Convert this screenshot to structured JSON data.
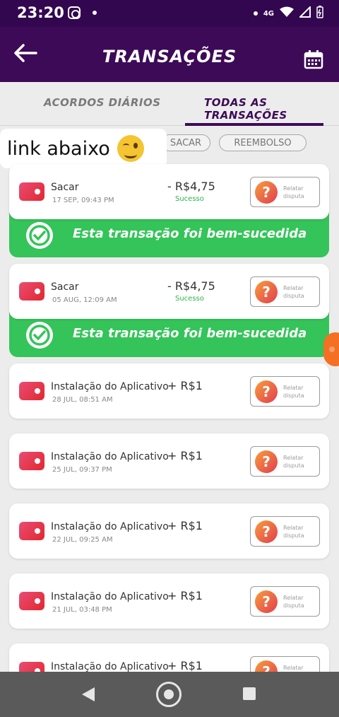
{
  "status_bar": {
    "time": "23:20",
    "network": "4G"
  },
  "app_bar": {
    "title": "TRANSAÇÕES"
  },
  "tabs": [
    {
      "label": "ACORDOS DIÁRIOS",
      "active": false
    },
    {
      "label": "TODAS AS TRANSAÇÕES",
      "active": true
    }
  ],
  "filters": [
    "SACAR",
    "REEMBOLSO"
  ],
  "sticker": {
    "text": "link abaixo"
  },
  "success_banner": "Esta transação foi bem-sucedida",
  "dispute_label": "Relatar disputa",
  "transactions": [
    {
      "name": "Sacar",
      "date": "17 SEP, 09:43 PM",
      "amount": "- R$4,75",
      "status": "Sucesso"
    },
    {
      "name": "Sacar",
      "date": "05 AUG, 12:09 AM",
      "amount": "- R$4,75",
      "status": "Sucesso"
    },
    {
      "name": "Instalação do Aplicativo",
      "date": "28 JUL, 08:51 AM",
      "amount": "+ R$1",
      "status": ""
    },
    {
      "name": "Instalação do Aplicativo",
      "date": "25 JUL, 09:37 PM",
      "amount": "+ R$1",
      "status": ""
    },
    {
      "name": "Instalação do Aplicativo",
      "date": "22 JUL, 09:25 AM",
      "amount": "+ R$1",
      "status": ""
    },
    {
      "name": "Instalação do Aplicativo",
      "date": "21 JUL, 03:48 PM",
      "amount": "+ R$1",
      "status": ""
    },
    {
      "name": "Instalação do Aplicativo",
      "date": "",
      "amount": "+ R$1",
      "status": ""
    }
  ],
  "colors": {
    "brand": "#3d0a57",
    "success": "#34c459",
    "accent": "#f47025"
  }
}
